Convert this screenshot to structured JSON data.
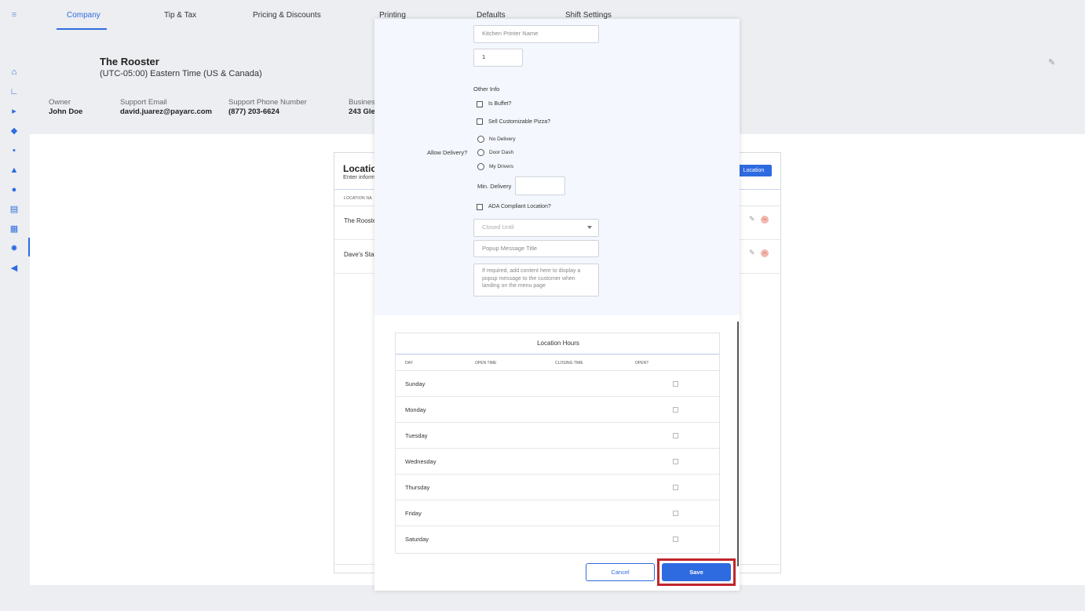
{
  "tabs": [
    "Company",
    "Tip & Tax",
    "Pricing & Discounts",
    "Printing",
    "Defaults",
    "Shift Settings"
  ],
  "company": {
    "name": "The Rooster",
    "timezone": "(UTC-05:00) Eastern Time (US & Canada)",
    "fields": [
      {
        "label": "Owner",
        "value": "John Doe"
      },
      {
        "label": "Support Email",
        "value": "david.juarez@payarc.com"
      },
      {
        "label": "Support Phone Number",
        "value": "(877) 203-6624"
      },
      {
        "label": "Busines",
        "value": "243 Gle"
      }
    ]
  },
  "locations": {
    "title": "Location",
    "subtitle": "Enter inform",
    "add_label": "Location",
    "column": "LOCATION NA",
    "rows": [
      "The Rooste",
      "Dave's Stan"
    ]
  },
  "modal": {
    "kitchen_printer_placeholder": "Kitchen Printer Name",
    "printer_count": "1",
    "other_info_label": "Other Info",
    "is_buffet_label": "Is Buffet?",
    "customizable_pizza_label": "Sell Customizable Pizza?",
    "allow_delivery_label": "Allow Delivery?",
    "delivery_options": [
      "No Delivery",
      "Door Dash",
      "My Drivers"
    ],
    "min_delivery_label": "Min. Delivery",
    "ada_label": "ADA Compliant Location?",
    "closed_until_placeholder": "Closed Until",
    "popup_title_placeholder": "Popup Message Title",
    "popup_content_placeholder": "If required, add content here to display a popup message to the customer when landing on the menu page",
    "hours": {
      "title": "Location Hours",
      "columns": [
        "DAY",
        "OPEN TIME",
        "CLOSING TIME",
        "OPEN?"
      ],
      "days": [
        "Sunday",
        "Monday",
        "Tuesday",
        "Wednesday",
        "Thursday",
        "Friday",
        "Saturday"
      ]
    },
    "cancel_label": "Cancel",
    "save_label": "Save"
  },
  "colors": {
    "accent": "#2f6be0",
    "highlight": "#c0262c"
  }
}
